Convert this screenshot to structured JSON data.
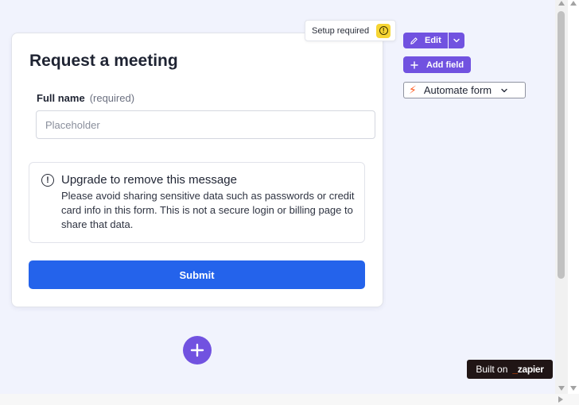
{
  "form": {
    "title": "Request a meeting",
    "field": {
      "label": "Full name",
      "required_text": "(required)",
      "placeholder": "Placeholder"
    },
    "notice": {
      "icon": "info-icon",
      "title": "Upgrade to remove this message",
      "body": "Please avoid sharing sensitive data such as passwords or credit card info in this form. This is not a secure login or billing page to share that data."
    },
    "submit_label": "Submit"
  },
  "setup_badge": {
    "text": "Setup required",
    "icon": "warning-icon",
    "color": "#f6d533"
  },
  "toolbar": {
    "edit_label": "Edit",
    "edit_icon": "pencil-icon",
    "caret_icon": "chevron-down-icon",
    "add_field_label": "Add field",
    "add_field_icon": "plus-icon",
    "automate_label": "Automate form",
    "automate_icon": "bolt-icon"
  },
  "add_block": {
    "icon": "plus-icon"
  },
  "footer": {
    "built_on_text": "Built on",
    "brand": "zapier"
  },
  "colors": {
    "accent": "#7152e0",
    "primary_button": "#2463eb",
    "background": "#f1f3fd",
    "bolt": "#ff5a1f"
  }
}
